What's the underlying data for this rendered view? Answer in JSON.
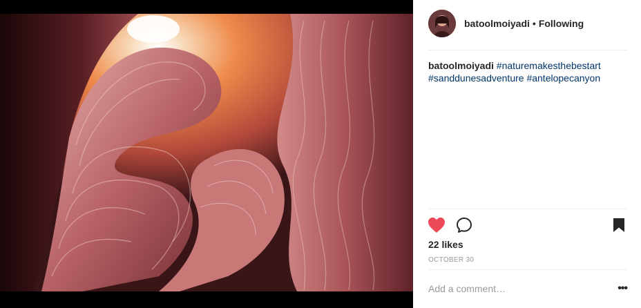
{
  "post": {
    "username": "batoolmoiyadi",
    "separator": "•",
    "follow_status": "Following",
    "caption": {
      "username": "batoolmoiyadi",
      "hashtags": [
        "#naturemakesthebestart",
        "#sanddunesadventure",
        "#antelopecanyon"
      ]
    },
    "likes": "22 likes",
    "date": "OCTOBER 30",
    "comment_placeholder": "Add a comment…",
    "more_label": "•••"
  },
  "icons": {
    "like": "heart-icon",
    "comment": "comment-bubble-icon",
    "save": "bookmark-icon",
    "more": "more-options-icon"
  },
  "colors": {
    "like_heart": "#ed4956",
    "hashtag": "#003569",
    "text": "#262626",
    "muted": "#999999"
  }
}
